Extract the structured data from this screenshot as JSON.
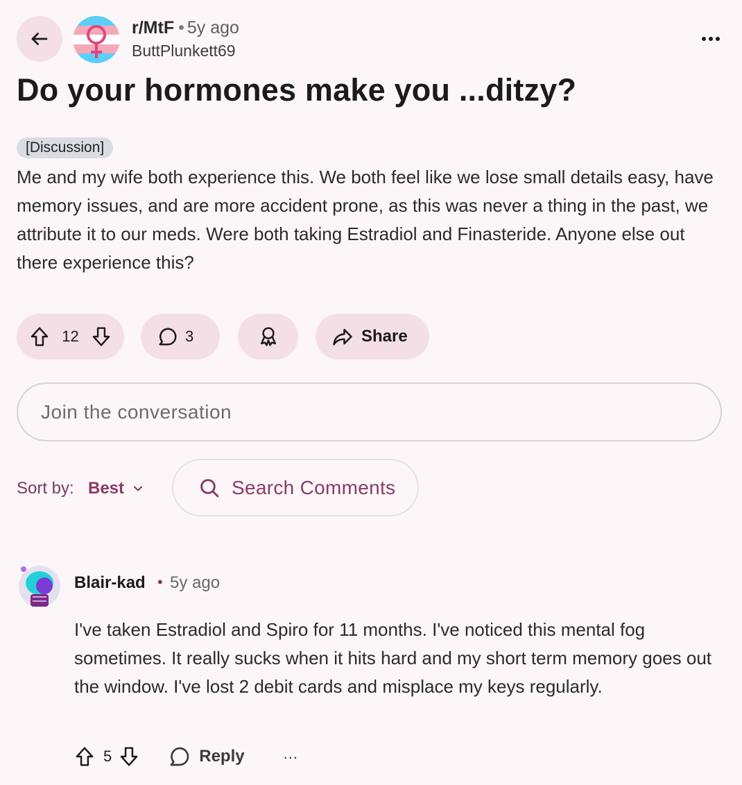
{
  "header": {
    "subreddit": "r/MtF",
    "separator": "•",
    "time_ago": "5y ago",
    "author": "ButtPlunkett69"
  },
  "post": {
    "title": "Do your hormones make you ...ditzy?",
    "flair": "[Discussion]",
    "body": "Me and my wife both experience this. We both feel like we lose small details easy, have memory issues, and are more accident prone, as this was never a thing in the past, we attribute it to our meds. Were both taking Estradiol and Finasteride. Anyone else out there experience this?",
    "votes": "12",
    "comments": "3",
    "share_label": "Share"
  },
  "composer": {
    "placeholder": "Join the conversation"
  },
  "sort": {
    "label": "Sort by:",
    "value": "Best",
    "search_placeholder": "Search Comments"
  },
  "comments": [
    {
      "author": "Blair-kad",
      "separator": "•",
      "time_ago": "5y ago",
      "body": "I've taken Estradiol and Spiro for 11 months. I've noticed this mental fog sometimes. It really sucks when it hits hard and my short term memory goes out the window. I've lost 2 debit cards and misplace my keys regularly.",
      "votes": "5",
      "reply_label": "Reply",
      "more_label": "..."
    }
  ],
  "colors": {
    "background": "#fcf6f8",
    "pill": "#f5dfe6",
    "accent": "#8b3a65",
    "trans_blue": "#5bcefa",
    "trans_pink": "#f5a9b8"
  },
  "icons": {
    "back": "arrow-left-icon",
    "more": "ellipsis-icon",
    "upvote": "arrow-up-icon",
    "downvote": "arrow-down-icon",
    "comment": "speech-bubble-icon",
    "award": "award-ribbon-icon",
    "share": "share-arrow-icon",
    "search": "search-icon",
    "chevron": "chevron-down-icon"
  }
}
